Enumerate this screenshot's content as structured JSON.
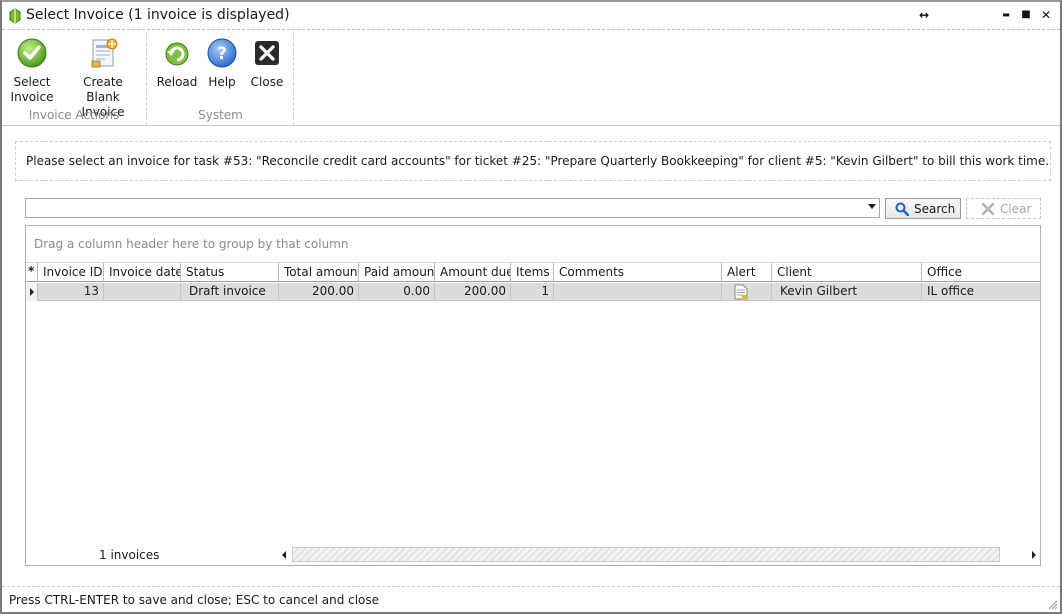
{
  "window": {
    "title": "Select Invoice (1 invoice is displayed)",
    "controls": {
      "restore": "↔",
      "minimize": "▬",
      "maximize": "■",
      "close": "✕"
    }
  },
  "ribbon": {
    "groups": [
      {
        "caption": "Invoice Actions",
        "buttons": [
          {
            "label": "Select\nInvoice",
            "icon": "check-icon"
          },
          {
            "label": "Create Blank\nInvoice",
            "icon": "blank-invoice-icon"
          }
        ]
      },
      {
        "caption": "System",
        "buttons": [
          {
            "label": "Reload",
            "icon": "reload-icon"
          },
          {
            "label": "Help",
            "icon": "help-icon"
          },
          {
            "label": "Close",
            "icon": "close-icon"
          }
        ]
      }
    ]
  },
  "message": "Please select an invoice for task #53: \"Reconcile credit card accounts\" for ticket #25: \"Prepare Quarterly Bookkeeping\" for client #5: \"Kevin Gilbert\" to bill this work time.",
  "search": {
    "value": "",
    "button_label": "Search",
    "clear_label": "Clear"
  },
  "grid": {
    "group_panel_hint": "Drag a column header here to group by that column",
    "header_marker": "*",
    "columns": [
      "Invoice ID",
      "Invoice date",
      "Status",
      "Total amount",
      "Paid amount",
      "Amount due",
      "Items",
      "Comments",
      "Alert",
      "Client",
      "Office"
    ],
    "rows": [
      {
        "invoice_id": "13",
        "invoice_date": "",
        "status": "Draft invoice",
        "total_amount": "200.00",
        "paid_amount": "0.00",
        "amount_due": "200.00",
        "items": "1",
        "comments": "",
        "alert": "document-icon",
        "client": "Kevin Gilbert",
        "office": "IL office"
      }
    ],
    "footer_count": "1 invoices"
  },
  "status_bar": "Press CTRL-ENTER to save and close; ESC to cancel and close",
  "colors": {
    "accent_green": "#4c9a1f",
    "help_blue": "#2f6fd0",
    "row_selected": "#dcdcdc"
  }
}
